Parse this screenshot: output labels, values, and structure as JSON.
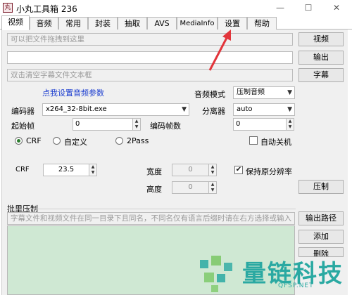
{
  "window": {
    "title": "小丸工具箱 236",
    "icon_glyph": "丸",
    "minimize": "—",
    "maximize": "☐",
    "close": "✕"
  },
  "tabs": [
    "视频",
    "音频",
    "常用",
    "封装",
    "抽取",
    "AVS",
    "MediaInfo",
    "设置",
    "帮助"
  ],
  "active_tab": "视频",
  "video": {
    "file_drop_placeholder": "可以把文件拖拽到这里",
    "video_button": "视频",
    "output_value": "",
    "output_button": "输出",
    "subtitle_placeholder": "双击清空字幕文件文本框",
    "subtitle_button": "字幕",
    "audio_settings_link": "点我设置音频参数",
    "audio_mode_label": "音频模式",
    "audio_mode_value": "压制音频",
    "encoder_label": "编码器",
    "encoder_value": "x264_32-8bit.exe",
    "splitter_label": "分离器",
    "splitter_value": "auto",
    "start_frame_label": "起始帧",
    "start_frame_value": "0",
    "encode_frames_label": "编码帧数",
    "encode_frames_value": "0",
    "radio_crf": "CRF",
    "radio_custom": "自定义",
    "radio_2pass": "2Pass",
    "auto_shutdown": "自动关机",
    "crf_label": "CRF",
    "crf_value": "23.5",
    "width_label": "宽度",
    "width_value": "0",
    "height_label": "高度",
    "height_value": "0",
    "keep_resolution": "保持原分辨率",
    "encode_button": "压制",
    "batch_label": "批里压制",
    "batch_hint": "字幕文件和视频文件在同一目录下且同名，不同名仅有语言后缀时请在右方选择或输入",
    "output_path_button": "输出路径",
    "add_button": "添加",
    "delete_button": "删除"
  },
  "watermark": {
    "brand": "量链科技",
    "url": "QFSP.NET"
  },
  "colors": {
    "arrow": "#e2353b",
    "batch_list_bg": "#cfe8d3",
    "link": "#1a3ccf",
    "watermark": "#2aa9a2"
  }
}
